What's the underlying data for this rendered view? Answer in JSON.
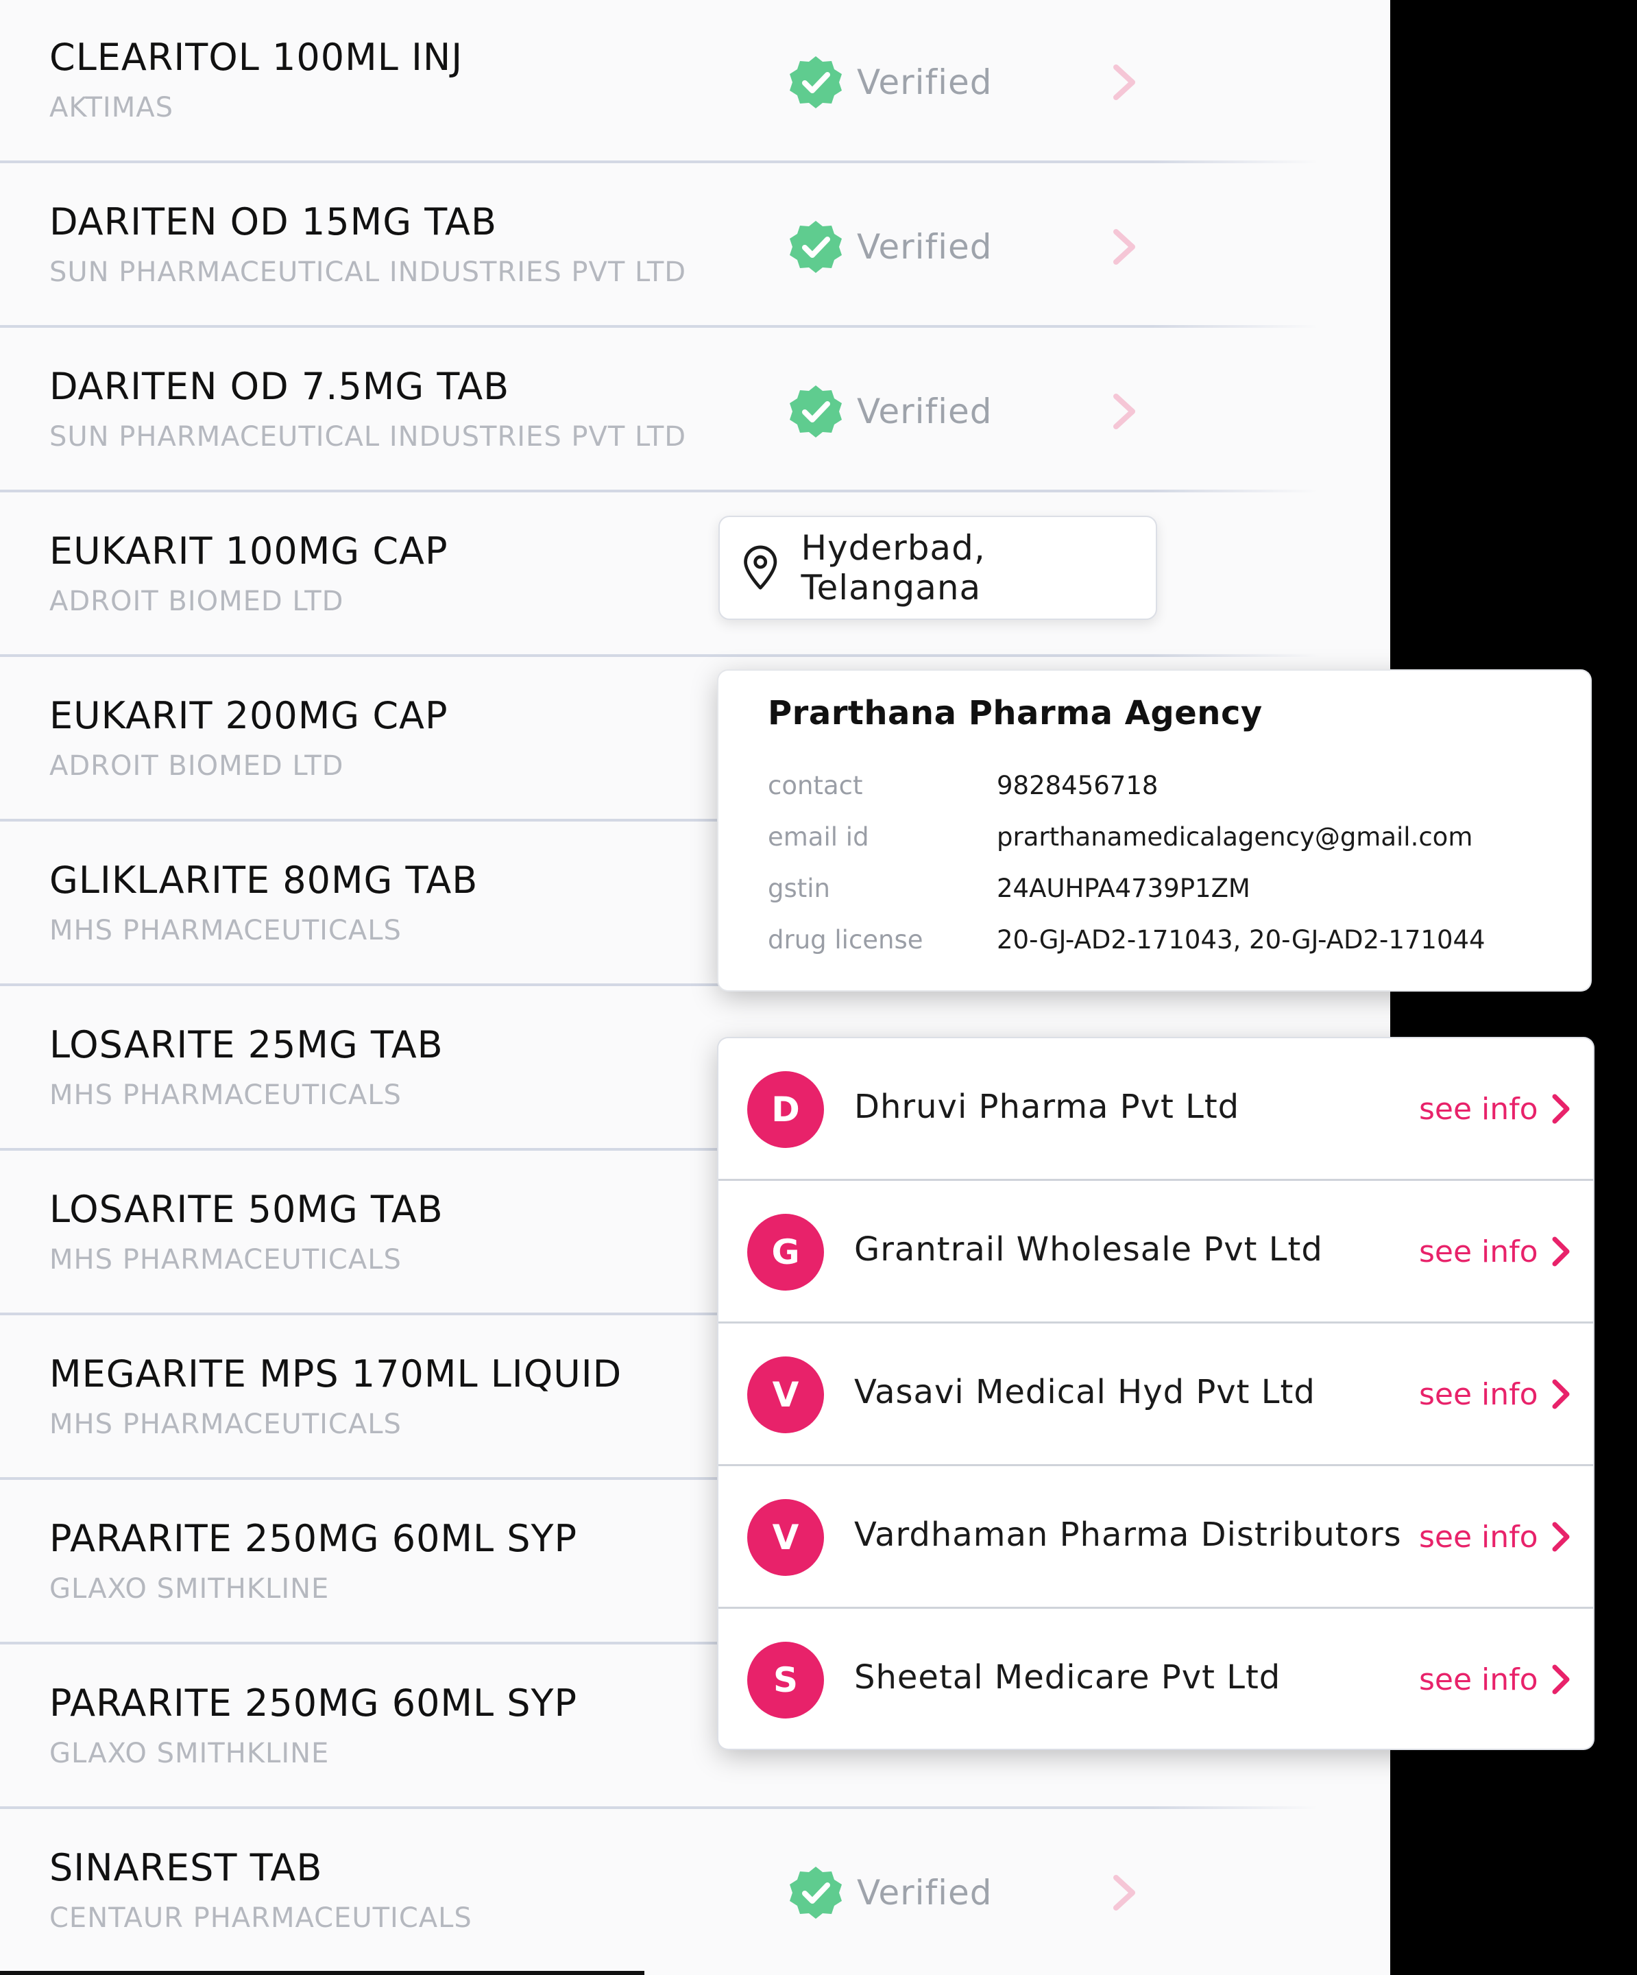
{
  "colors": {
    "accent": "#e8226a",
    "verified_green": "#5fcc8f",
    "muted_text": "#b5b8bf",
    "divider": "#d3d8e4"
  },
  "products": [
    {
      "name": "CLEARITOL 100ML INJ",
      "maker": "AKTIMAS",
      "verified": true
    },
    {
      "name": "DARITEN OD 15MG TAB",
      "maker": "SUN PHARMACEUTICAL INDUSTRIES PVT LTD",
      "verified": true
    },
    {
      "name": "DARITEN OD 7.5MG TAB",
      "maker": "SUN PHARMACEUTICAL INDUSTRIES PVT LTD",
      "verified": true
    },
    {
      "name": "EUKARIT 100MG CAP",
      "maker": "ADROIT BIOMED LTD",
      "verified": false
    },
    {
      "name": "EUKARIT 200MG CAP",
      "maker": "ADROIT BIOMED LTD",
      "verified": false
    },
    {
      "name": "GLIKLARITE 80MG TAB",
      "maker": "MHS PHARMACEUTICALS",
      "verified": false
    },
    {
      "name": "LOSARITE 25MG TAB",
      "maker": "MHS PHARMACEUTICALS",
      "verified": false
    },
    {
      "name": "LOSARITE 50MG TAB",
      "maker": "MHS PHARMACEUTICALS",
      "verified": false
    },
    {
      "name": "MEGARITE MPS 170ML LIQUID",
      "maker": "MHS PHARMACEUTICALS",
      "verified": false
    },
    {
      "name": "PARARITE 250MG 60ML SYP",
      "maker": "GLAXO SMITHKLINE",
      "verified": false
    },
    {
      "name": "PARARITE 250MG 60ML SYP",
      "maker": "GLAXO SMITHKLINE",
      "verified": false
    },
    {
      "name": "SINAREST TAB",
      "maker": "CENTAUR PHARMACEUTICALS",
      "verified": true
    }
  ],
  "verified_label": "Verified",
  "verified_icon": "check-badge-icon",
  "row_arrow_icon": "chevron-right-icon",
  "location": {
    "icon": "map-pin-icon",
    "text": "Hyderbad, Telangana"
  },
  "distributor_detail": {
    "name": "Prarthana Pharma Agency",
    "fields": [
      {
        "label": "contact",
        "value": "9828456718"
      },
      {
        "label": "email id",
        "value": "prarthanamedicalagency@gmail.com"
      },
      {
        "label": "gstin",
        "value": "24AUHPA4739P1ZM"
      },
      {
        "label": "drug license",
        "value": "20-GJ-AD2-171043, 20-GJ-AD2-171044"
      }
    ]
  },
  "distributors": [
    {
      "initial": "D",
      "name": "Dhruvi Pharma Pvt Ltd",
      "action": "see info"
    },
    {
      "initial": "G",
      "name": "Grantrail Wholesale Pvt Ltd",
      "action": "see info"
    },
    {
      "initial": "V",
      "name": "Vasavi Medical Hyd Pvt Ltd",
      "action": "see info"
    },
    {
      "initial": "V",
      "name": "Vardhaman Pharma Distributors",
      "action": "see info"
    },
    {
      "initial": "S",
      "name": "Sheetal Medicare Pvt Ltd",
      "action": "see info"
    }
  ]
}
